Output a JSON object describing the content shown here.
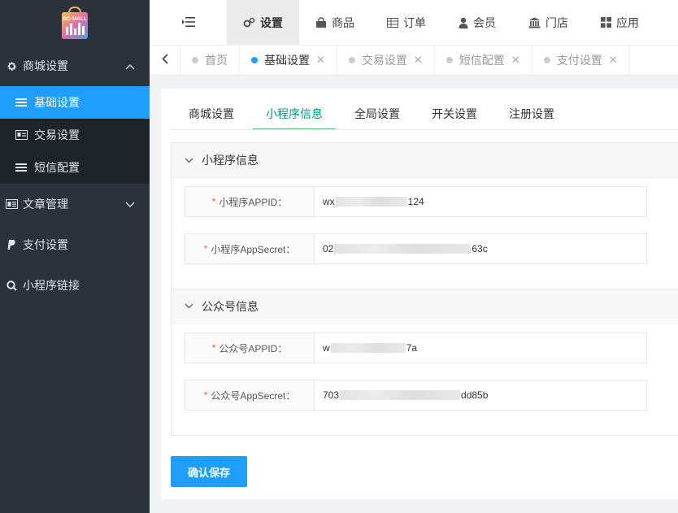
{
  "logo": {
    "text": "DC-MALL"
  },
  "sidebar": {
    "groups": [
      {
        "label": "商城设置",
        "icon": "gear-icon",
        "expanded": true,
        "items": [
          {
            "label": "基础设置",
            "icon": "list-icon",
            "active": true
          },
          {
            "label": "交易设置",
            "icon": "card-icon"
          },
          {
            "label": "短信配置",
            "icon": "list-icon"
          }
        ]
      },
      {
        "label": "文章管理",
        "icon": "news-icon"
      },
      {
        "label": "支付设置",
        "icon": "paypal-icon"
      },
      {
        "label": "小程序链接",
        "icon": "search-icon"
      }
    ]
  },
  "topnav": {
    "items": [
      {
        "label": "设置",
        "icon": "gears-icon",
        "active": true
      },
      {
        "label": "商品",
        "icon": "bag-icon"
      },
      {
        "label": "订单",
        "icon": "table-icon"
      },
      {
        "label": "会员",
        "icon": "user-icon"
      },
      {
        "label": "门店",
        "icon": "bank-icon"
      },
      {
        "label": "应用",
        "icon": "grid-icon"
      }
    ]
  },
  "pagetabs": [
    {
      "label": "首页",
      "closable": false
    },
    {
      "label": "基础设置",
      "closable": true,
      "active": true
    },
    {
      "label": "交易设置",
      "closable": true
    },
    {
      "label": "短信配置",
      "closable": true
    },
    {
      "label": "支付设置",
      "closable": true
    }
  ],
  "subtabs": [
    "商城设置",
    "小程序信息",
    "全局设置",
    "开关设置",
    "注册设置"
  ],
  "subtab_active": "小程序信息",
  "section1": {
    "title": "小程序信息",
    "fields": [
      {
        "label": "小程序APPID：",
        "prefix": "wx",
        "suffix": "124"
      },
      {
        "label": "小程序AppSecret：",
        "prefix": "02",
        "suffix": "63c"
      }
    ]
  },
  "section2": {
    "title": "公众号信息",
    "fields": [
      {
        "label": "公众号APPID：",
        "prefix": "w",
        "suffix": "7a"
      },
      {
        "label": "公众号AppSecret：",
        "prefix": "703",
        "suffix": "dd85b"
      }
    ]
  },
  "save_label": "确认保存",
  "colors": {
    "accent": "#1e9fff",
    "sidebar_bg": "#2b323c",
    "tab_green": "#009688",
    "required": "#ff5722"
  }
}
